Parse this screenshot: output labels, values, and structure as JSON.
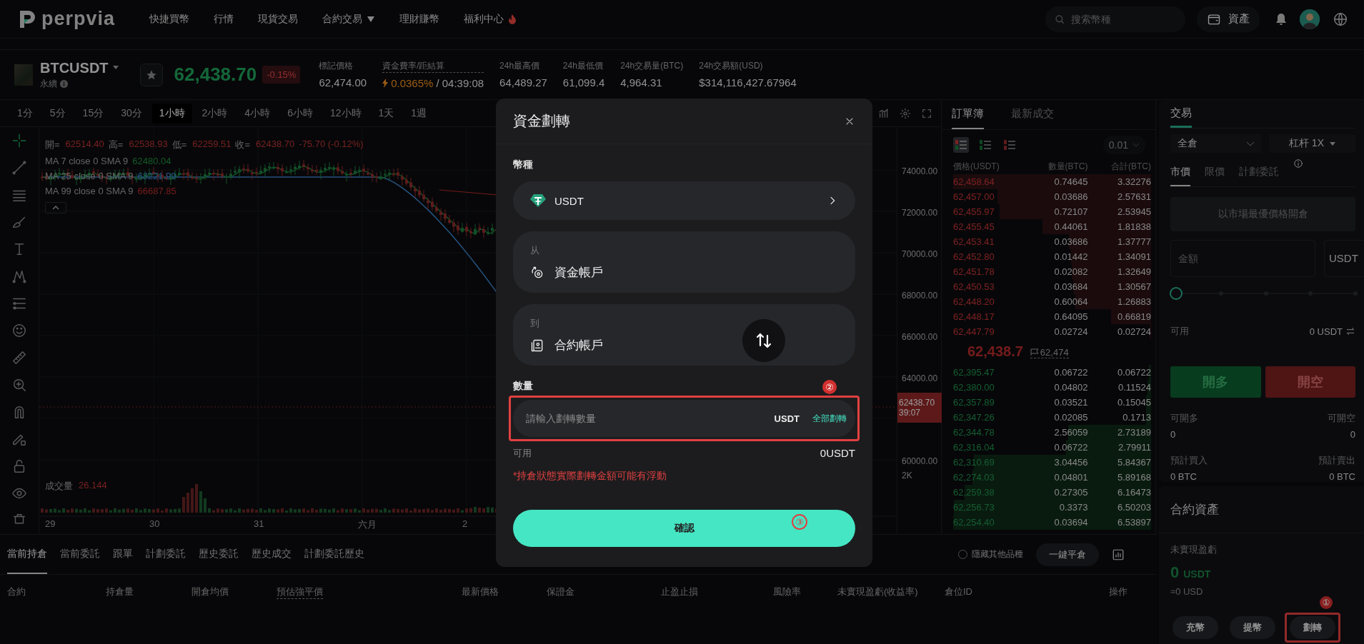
{
  "nav": {
    "logo": "perpvia",
    "links": [
      {
        "label": "快捷買幣",
        "kind": "link"
      },
      {
        "label": "行情",
        "kind": "link"
      },
      {
        "label": "現貨交易",
        "kind": "link"
      },
      {
        "label": "合約交易",
        "kind": "dropdown"
      },
      {
        "label": "理財賺幣",
        "kind": "link"
      },
      {
        "label": "福利中心",
        "kind": "hot"
      }
    ],
    "search": {
      "placeholder": "搜索幣種"
    },
    "assets_button": "資產"
  },
  "ticker": {
    "symbol": "BTCUSDT",
    "contract_type": "永續",
    "price": "62,438.70",
    "change": "-0.15%",
    "stats": [
      {
        "label": "標記價格",
        "value": "62,474.00",
        "kind": "plain"
      },
      {
        "label": "資金費率/距結算",
        "value": "0.0365%",
        "extra": "/ 04:39:08",
        "kind": "funding"
      },
      {
        "label": "24h最高價",
        "value": "64,489.27",
        "kind": "plain"
      },
      {
        "label": "24h最低價",
        "value": "61,099.4",
        "kind": "plain"
      },
      {
        "label": "24h交易量(BTC)",
        "value": "4,964.31",
        "kind": "plain"
      },
      {
        "label": "24h交易額(USD)",
        "value": "$314,116,427.67964",
        "kind": "plain"
      }
    ]
  },
  "timeframes": [
    {
      "label": "1分",
      "selected": false
    },
    {
      "label": "5分",
      "selected": false
    },
    {
      "label": "15分",
      "selected": false
    },
    {
      "label": "30分",
      "selected": false
    },
    {
      "label": "1小時",
      "selected": true
    },
    {
      "label": "2小時",
      "selected": false
    },
    {
      "label": "4小時",
      "selected": false
    },
    {
      "label": "6小時",
      "selected": false
    },
    {
      "label": "12小時",
      "selected": false
    },
    {
      "label": "1天",
      "selected": false
    },
    {
      "label": "1週",
      "selected": false
    }
  ],
  "chart": {
    "legend": [
      {
        "label": "開=",
        "value": "62514.40"
      },
      {
        "label": "高=",
        "value": "62538.93"
      },
      {
        "label": "低=",
        "value": "62259.51"
      },
      {
        "label": "收=",
        "value": "62438.70"
      }
    ],
    "legend_change": "-75.70 (-0.12%)",
    "indicators": [
      {
        "label": "MA 7 close 0 SMA 9",
        "value": "62480.04"
      },
      {
        "label": "MA 25 close 0 SMA 9",
        "value": "63221.99"
      },
      {
        "label": "MA 99 close 0 SMA 9",
        "value": "66687.85"
      }
    ],
    "price_axis": [
      "74000.00",
      "72000.00",
      "70000.00",
      "68000.00",
      "66000.00",
      "64000.00",
      "60000.00"
    ],
    "volume_axis": "2K",
    "last_price_tag": {
      "price": "62438.70",
      "countdown": "39:07"
    },
    "volume_label": "成交量",
    "volume_value": "26.144",
    "time_axis": [
      "29",
      "30",
      "31",
      "六月",
      "2"
    ]
  },
  "order_book": {
    "tabs": [
      {
        "label": "訂單簿",
        "selected": true
      },
      {
        "label": "最新成交",
        "selected": false
      }
    ],
    "view_modes": [
      {
        "kind": "both",
        "selected": true
      },
      {
        "kind": "bids",
        "selected": false
      },
      {
        "kind": "asks",
        "selected": false
      }
    ],
    "precision": "0.01",
    "columns": [
      "價格(USDT)",
      "數量(BTC)",
      "合計(BTC)"
    ],
    "asks": [
      {
        "price": "62,458.64",
        "amount": "0.74645",
        "total": "3.32276"
      },
      {
        "price": "62,457.00",
        "amount": "0.03686",
        "total": "2.57631"
      },
      {
        "price": "62,455.97",
        "amount": "0.72107",
        "total": "2.53945"
      },
      {
        "price": "62,455.45",
        "amount": "0.44061",
        "total": "1.81838"
      },
      {
        "price": "62,453.41",
        "amount": "0.03686",
        "total": "1.37777"
      },
      {
        "price": "62,452.80",
        "amount": "0.01442",
        "total": "1.34091"
      },
      {
        "price": "62,451.78",
        "amount": "0.02082",
        "total": "1.32649"
      },
      {
        "price": "62,450.53",
        "amount": "0.03684",
        "total": "1.30567"
      },
      {
        "price": "62,448.20",
        "amount": "0.60064",
        "total": "1.26883"
      },
      {
        "price": "62,448.17",
        "amount": "0.64095",
        "total": "0.66819"
      },
      {
        "price": "62,447.79",
        "amount": "0.02724",
        "total": "0.02724"
      }
    ],
    "last_price": "62,438.7",
    "mark_price": "62,474",
    "bids": [
      {
        "price": "62,395.47",
        "amount": "0.06722",
        "total": "0.06722"
      },
      {
        "price": "62,380.00",
        "amount": "0.04802",
        "total": "0.11524"
      },
      {
        "price": "62,357.89",
        "amount": "0.03521",
        "total": "0.15045"
      },
      {
        "price": "62,347.26",
        "amount": "0.02085",
        "total": "0.1713"
      },
      {
        "price": "62,344.78",
        "amount": "2.56059",
        "total": "2.73189"
      },
      {
        "price": "62,316.04",
        "amount": "0.06722",
        "total": "2.79911"
      },
      {
        "price": "62,310.69",
        "amount": "3.04456",
        "total": "5.84367"
      },
      {
        "price": "62,274.03",
        "amount": "0.04801",
        "total": "5.89168"
      },
      {
        "price": "62,259.38",
        "amount": "0.27305",
        "total": "6.16473"
      },
      {
        "price": "62,256.73",
        "amount": "0.3373",
        "total": "6.50203"
      },
      {
        "price": "62,254.40",
        "amount": "0.03694",
        "total": "6.53897"
      }
    ]
  },
  "trade": {
    "tab": "交易",
    "margin_mode": "全倉",
    "leverage": "杠杆 1X",
    "order_types": [
      {
        "label": "市價",
        "selected": true
      },
      {
        "label": "限價",
        "selected": false
      },
      {
        "label": "計劃委託",
        "selected": false
      }
    ],
    "market_hint": "以市場最優價格開倉",
    "amount": {
      "placeholder": "金額"
    },
    "unit": "USDT",
    "slider": {
      "level": 0
    },
    "available": {
      "label": "可用",
      "value": "0 USDT"
    },
    "long_button": "開多",
    "short_button": "開空",
    "stats": [
      {
        "left_label": "可開多",
        "left_value": "0",
        "right_label": "可開空",
        "right_value": "0"
      },
      {
        "left_label": "預計買入",
        "left_value": "0 BTC",
        "right_label": "預計賣出",
        "right_value": "0 BTC"
      }
    ]
  },
  "assets": {
    "title": "合約資產",
    "pnl_label": "未實現盈虧",
    "pnl_value": "0",
    "pnl_unit": "USDT",
    "pnl_usd": "≈0 USD",
    "buttons": [
      {
        "label": "充幣",
        "highlighted": false
      },
      {
        "label": "提幣",
        "highlighted": false
      },
      {
        "label": "劃轉",
        "highlighted": true,
        "marker": "①"
      }
    ]
  },
  "positions": {
    "tabs": [
      {
        "label": "當前持倉",
        "selected": true
      },
      {
        "label": "當前委託",
        "selected": false
      },
      {
        "label": "跟單",
        "selected": false
      },
      {
        "label": "計劃委託",
        "selected": false
      },
      {
        "label": "歷史委託",
        "selected": false
      },
      {
        "label": "歷史成交",
        "selected": false
      },
      {
        "label": "計劃委託歷史",
        "selected": false
      }
    ],
    "hide_others": {
      "label": "隱藏其他品種",
      "checked": false
    },
    "close_all": "一鍵平倉",
    "columns": [
      {
        "label": "合約",
        "dashed": false
      },
      {
        "label": "持倉量",
        "dashed": false
      },
      {
        "label": "開倉均價",
        "dashed": false
      },
      {
        "label": "預估強平價",
        "dashed": true
      },
      {
        "label": "最新價格",
        "dashed": false
      },
      {
        "label": "保證金",
        "dashed": false
      },
      {
        "label": "止盈止損",
        "dashed": false
      },
      {
        "label": "風險率",
        "dashed": false
      },
      {
        "label": "未實現盈虧(收益率)",
        "dashed": false
      },
      {
        "label": "倉位ID",
        "dashed": false
      },
      {
        "label": "操作",
        "dashed": false
      }
    ]
  },
  "modal": {
    "title": "資金劃轉",
    "currency_label": "幣種",
    "currency": "USDT",
    "from_label": "从",
    "from_account": "資金帳戶",
    "to_label": "到",
    "to_account": "合約帳戶",
    "amount_label": "數量",
    "amount_marker": "②",
    "amount_highlighted": true,
    "amount_placeholder": "請輸入劃轉數量",
    "amount_unit": "USDT",
    "max_button": "全部劃轉",
    "available_label": "可用",
    "available_value": "0USDT",
    "note": "*持倉狀態實際劃轉金額可能有浮動",
    "confirm": "確認",
    "confirm_marker": "③"
  }
}
